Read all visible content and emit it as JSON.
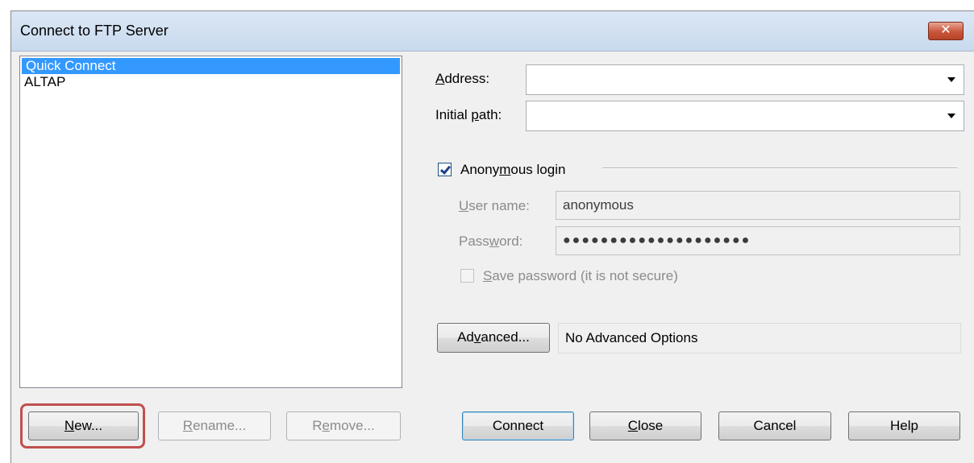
{
  "window": {
    "title": "Connect to FTP Server",
    "close_label": "✕"
  },
  "bookmarks": {
    "items": [
      "Quick Connect",
      "ALTAP"
    ],
    "selected_index": 0
  },
  "form": {
    "address_label_pre": "",
    "address_label_u": "A",
    "address_label_post": "ddress:",
    "address_value": "",
    "initial_path_label_pre": "Initial ",
    "initial_path_label_u": "p",
    "initial_path_label_post": "ath:",
    "initial_path_value": "",
    "anonymous_login_pre": "Anony",
    "anonymous_login_u": "m",
    "anonymous_login_post": "ous login",
    "anonymous_checked": true,
    "user_name_label_u": "U",
    "user_name_label_post": "ser name:",
    "user_name_value": "anonymous",
    "password_label_pre": "Pass",
    "password_label_u": "w",
    "password_label_post": "ord:",
    "password_value": "●●●●●●●●●●●●●●●●●●●●",
    "save_password_u": "S",
    "save_password_post": "ave password (it is not secure)",
    "save_password_checked": false,
    "advanced_button_pre": "Ad",
    "advanced_button_u": "v",
    "advanced_button_post": "anced...",
    "advanced_options_text": "No Advanced Options"
  },
  "buttons": {
    "new_u": "N",
    "new_post": "ew...",
    "rename_u": "R",
    "rename_post": "ename...",
    "remove_pre": "R",
    "remove_u": "e",
    "remove_post": "move...",
    "connect": "Connect",
    "close_u": "C",
    "close_post": "lose",
    "cancel": "Cancel",
    "help": "Help"
  },
  "colors": {
    "selection": "#3399ff",
    "highlight_frame": "#c0504d",
    "title_bar": "#c9daee"
  }
}
